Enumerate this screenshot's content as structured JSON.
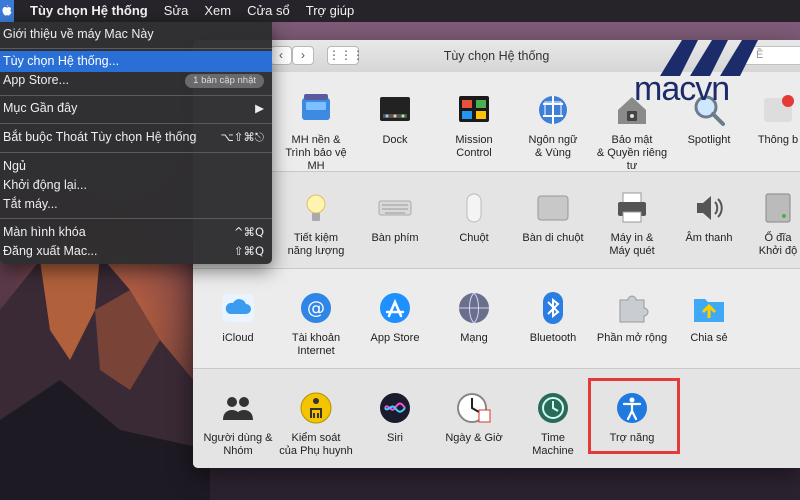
{
  "menubar": {
    "items": [
      "Tùy chọn Hệ thống",
      "Sửa",
      "Xem",
      "Cửa sổ",
      "Trợ giúp"
    ]
  },
  "apple_menu": {
    "about": "Giới thiệu về máy Mac Này",
    "system_prefs": "Tùy chọn Hệ thống...",
    "app_store": "App Store...",
    "app_store_badge": "1 bản cập nhật",
    "recent": "Mục Gần đây",
    "force_quit": "Bắt buộc Thoát Tùy chọn Hệ thống",
    "force_quit_shortcut": "⌥⇧⌘⎋",
    "sleep": "Ngủ",
    "restart": "Khởi động lại...",
    "shutdown": "Tắt máy...",
    "lock": "Màn hình khóa",
    "lock_shortcut": "^⌘Q",
    "logout": "Đăng xuất Mac...",
    "logout_shortcut": "⇧⌘Q"
  },
  "window": {
    "title": "Tùy chọn Hệ thống",
    "search_placeholder": "Ề"
  },
  "logo": {
    "text": "macvn"
  },
  "rows": {
    "r1": [
      "MH nền &\nTrình bảo vệ MH",
      "Dock",
      "Mission\nControl",
      "Ngôn ngữ\n& Vùng",
      "Bảo mật\n& Quyền riêng tư",
      "Spotlight",
      "Thông b"
    ],
    "r2": [
      "Tiết kiệm\nnăng lượng",
      "Bàn phím",
      "Chuột",
      "Bàn di chuột",
      "Máy in &\nMáy quét",
      "Âm thanh",
      "Ổ đĩa\nKhởi độ"
    ],
    "r3": [
      "iCloud",
      "Tài khoản\nInternet",
      "App Store",
      "Mạng",
      "Bluetooth",
      "Phần mở rộng",
      "Chia sẻ"
    ],
    "r4": [
      "Người dùng &\nNhóm",
      "Kiểm soát\ncủa Phụ huynh",
      "Siri",
      "Ngày & Giờ",
      "Time\nMachine",
      "Trợ năng"
    ]
  },
  "colors": {
    "accent": "#2a6fd6",
    "highlight": "#e23b3b",
    "logo": "#1c2c6b"
  }
}
